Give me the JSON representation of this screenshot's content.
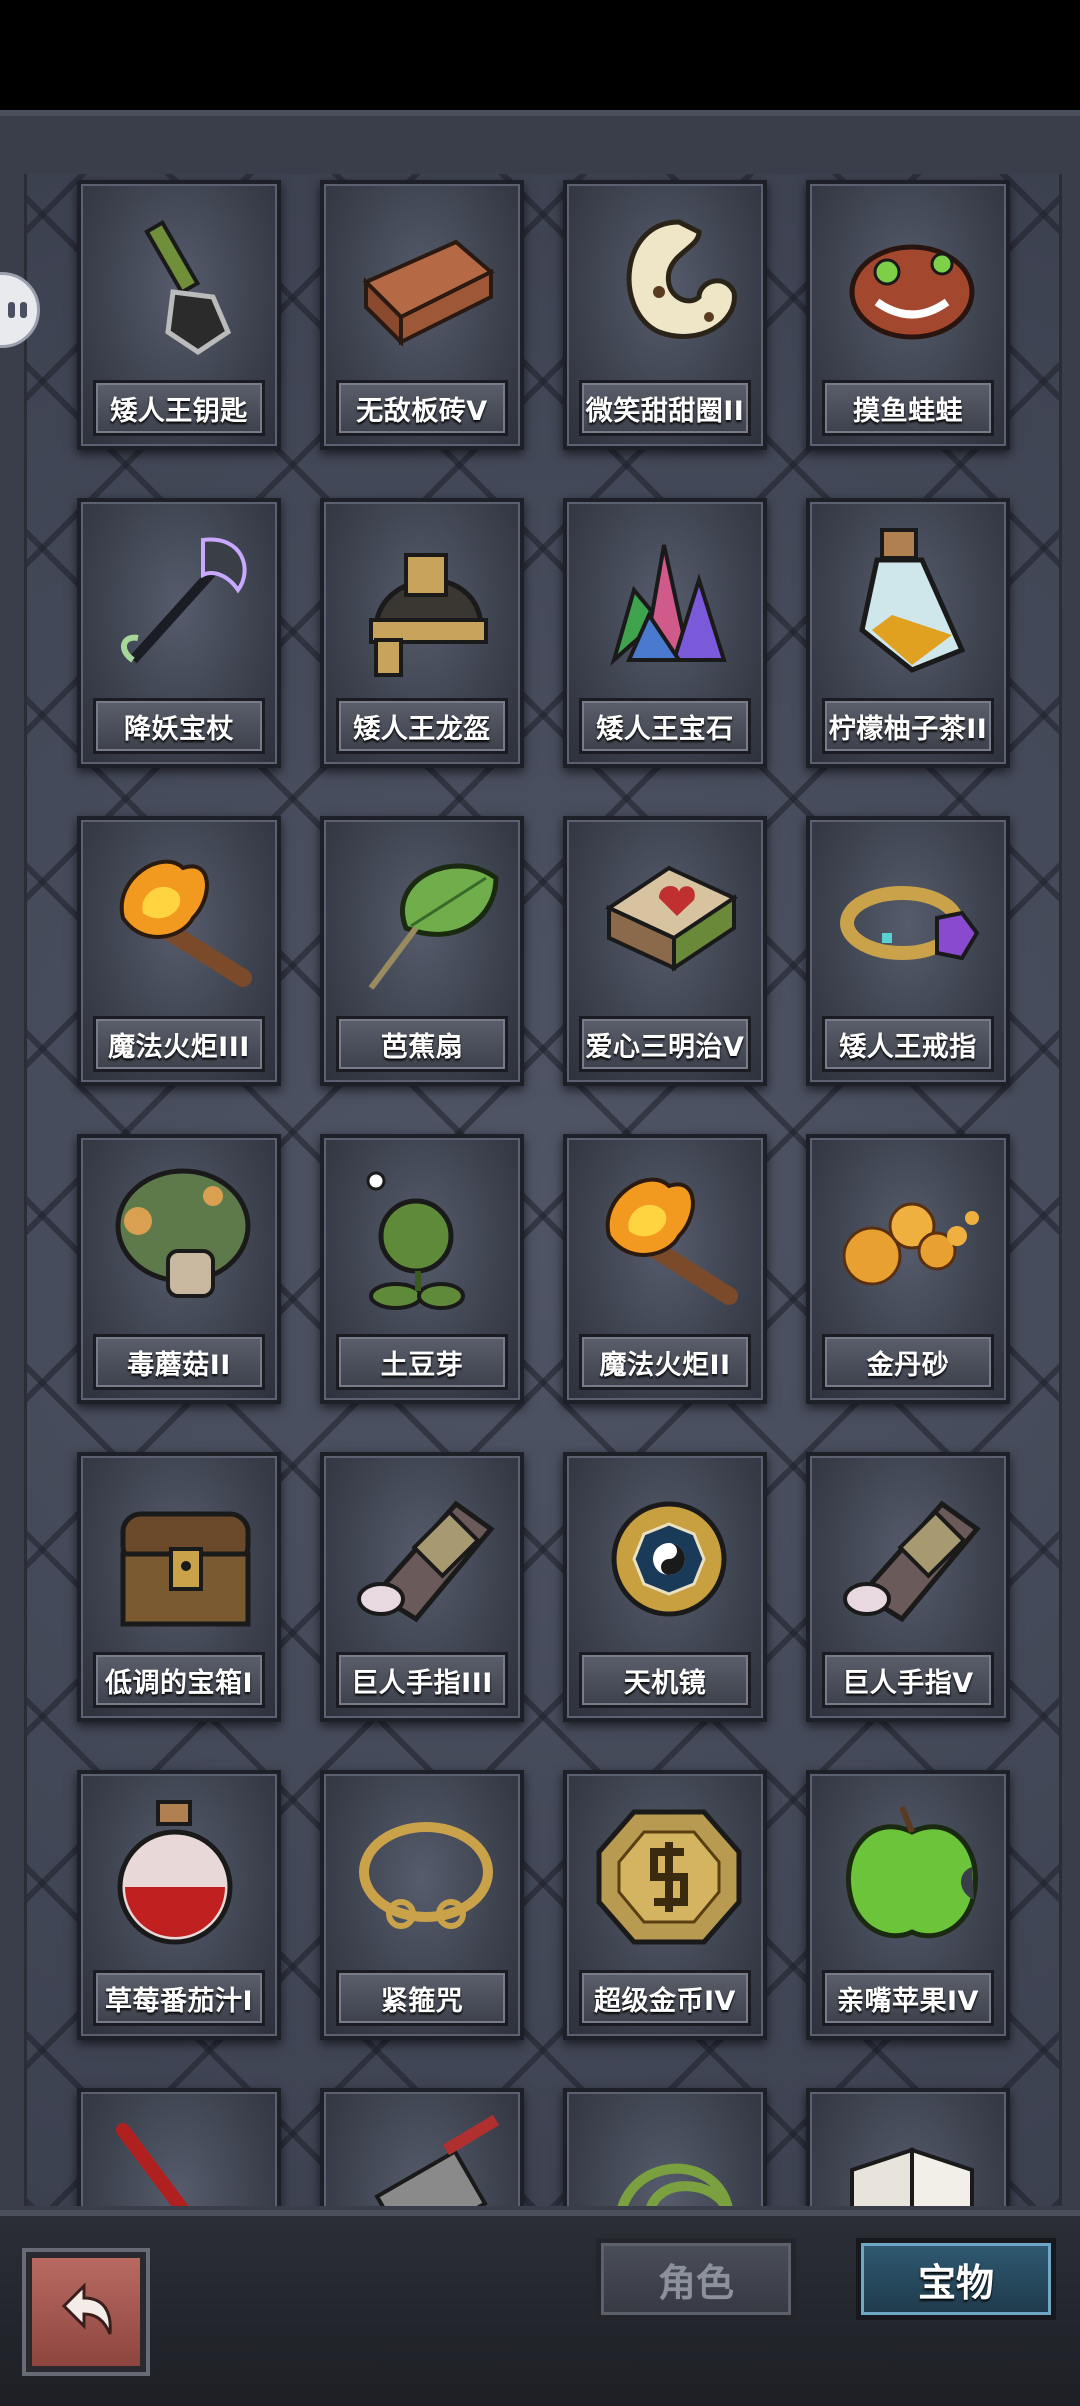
{
  "items": [
    {
      "label": "矮人王钥匙",
      "icon": "key-icon"
    },
    {
      "label": "无敌板砖V",
      "icon": "brick-icon"
    },
    {
      "label": "微笑甜甜圈II",
      "icon": "donut-icon"
    },
    {
      "label": "摸鱼蛙蛙",
      "icon": "frog-icon"
    },
    {
      "label": "降妖宝杖",
      "icon": "staff-icon"
    },
    {
      "label": "矮人王龙盔",
      "icon": "helmet-icon"
    },
    {
      "label": "矮人王宝石",
      "icon": "gem-icon"
    },
    {
      "label": "柠檬柚子茶II",
      "icon": "potion-bottle-icon"
    },
    {
      "label": "魔法火炬III",
      "icon": "torch-icon"
    },
    {
      "label": "芭蕉扇",
      "icon": "leaf-fan-icon"
    },
    {
      "label": "爱心三明治V",
      "icon": "sandwich-icon"
    },
    {
      "label": "矮人王戒指",
      "icon": "ring-icon"
    },
    {
      "label": "毒蘑菇II",
      "icon": "mushroom-icon"
    },
    {
      "label": "土豆芽",
      "icon": "sprout-plant-icon"
    },
    {
      "label": "魔法火炬II",
      "icon": "torch-icon"
    },
    {
      "label": "金丹砂",
      "icon": "gold-pills-icon"
    },
    {
      "label": "低调的宝箱I",
      "icon": "chest-icon"
    },
    {
      "label": "巨人手指III",
      "icon": "giant-finger-icon"
    },
    {
      "label": "天机镜",
      "icon": "bagua-mirror-icon"
    },
    {
      "label": "巨人手指V",
      "icon": "giant-finger-icon"
    },
    {
      "label": "草莓番茄汁I",
      "icon": "red-potion-icon"
    },
    {
      "label": "紧箍咒",
      "icon": "golden-circlet-icon"
    },
    {
      "label": "超级金币IV",
      "icon": "gold-coin-icon"
    },
    {
      "label": "亲嘴苹果IV",
      "icon": "apple-icon"
    }
  ],
  "partial_row_icons": [
    "stick-icon",
    "cleaver-icon",
    "coil-icon",
    "book-icon"
  ],
  "tabs": {
    "role": "角色",
    "treasure": "宝物"
  },
  "colors": {
    "card_bg": "#3b404c",
    "active_tab": "#2f5a72",
    "back_button": "#a3574f"
  }
}
